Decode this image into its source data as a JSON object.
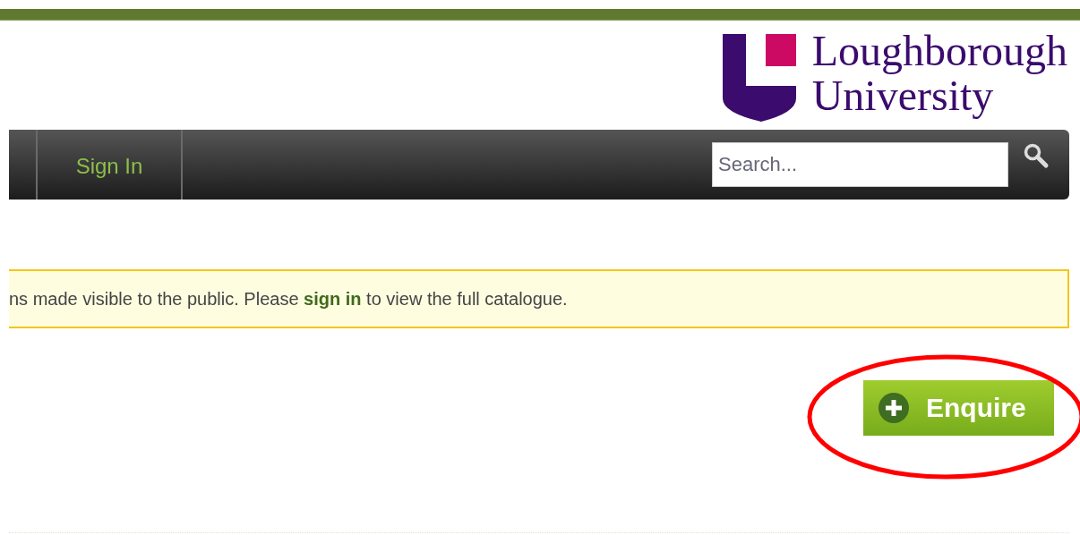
{
  "logo": {
    "line_1": "Loughborough",
    "line_2": "University"
  },
  "nav": {
    "items": [
      {
        "label": "Sign In"
      }
    ],
    "search": {
      "placeholder": "Search..."
    }
  },
  "notice": {
    "text": "ns made visible to the public. Please **sign in** to view the full catalogue."
  },
  "enquire_button": {
    "label": "Enquire"
  }
}
